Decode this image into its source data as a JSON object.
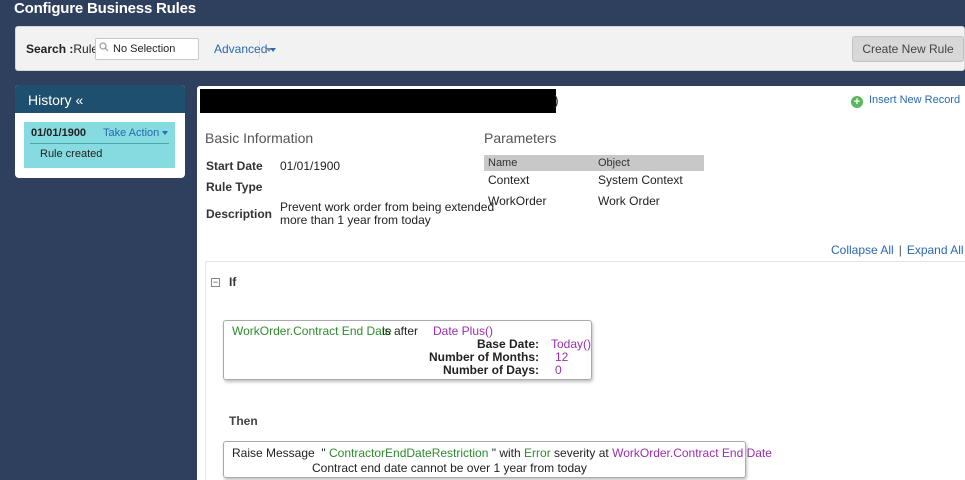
{
  "page": {
    "title": "Configure Business Rules"
  },
  "search": {
    "label_bold": "Search :",
    "label": "Rule",
    "value": "No Selection",
    "advanced": "Advanced",
    "create_button": "Create New Rule"
  },
  "history": {
    "title": "History «",
    "items": [
      {
        "date": "01/01/1900",
        "action": "Take Action",
        "note": "Rule created"
      }
    ]
  },
  "record": {
    "title_suffix": ")",
    "insert_link": "Insert New Record",
    "basic_info": {
      "heading": "Basic Information",
      "start_date_label": "Start Date",
      "start_date": "01/01/1900",
      "rule_type_label": "Rule Type",
      "rule_type": "",
      "description_label": "Description",
      "description_line1": "Prevent work order from being extended",
      "description_line2": "more than 1 year from today"
    },
    "parameters": {
      "heading": "Parameters",
      "columns": [
        "Name",
        "Object"
      ],
      "rows": [
        {
          "name": "Context",
          "object": "System Context"
        },
        {
          "name": "WorkOrder",
          "object": "Work Order"
        }
      ]
    },
    "collapse_all": "Collapse All",
    "separator": "|",
    "expand_all": "Expand All"
  },
  "rule": {
    "toggle": "−",
    "if_label": "If",
    "condition": {
      "field": "WorkOrder.Contract End Date",
      "operator": "is after",
      "function": "Date Plus()",
      "params": [
        {
          "label": "Base Date:",
          "value": "Today()"
        },
        {
          "label": "Number of Months:",
          "value": "12"
        },
        {
          "label": "Number of Days:",
          "value": "0"
        }
      ]
    },
    "then_label": "Then",
    "action": {
      "verb": "Raise Message",
      "quote_open": "\"",
      "message_name": "ContractorEndDateRestriction",
      "with_text": "\" with",
      "severity": "Error",
      "severity_at": "severity at",
      "target": "WorkOrder.Contract End Date",
      "message_text": "Contract end date cannot be over 1 year from today"
    }
  },
  "colors": {
    "background": "#2f3f5e",
    "history_header": "#1f4f6e",
    "history_item": "#85dbe0",
    "link": "#2a6ab0",
    "field_green": "#2e8b2e",
    "value_purple": "#9b2fae",
    "add_green": "#5cb85c"
  },
  "icons": [
    "search-icon",
    "chevron-down-icon",
    "plus-circle-icon",
    "collapse-toggle-icon"
  ]
}
